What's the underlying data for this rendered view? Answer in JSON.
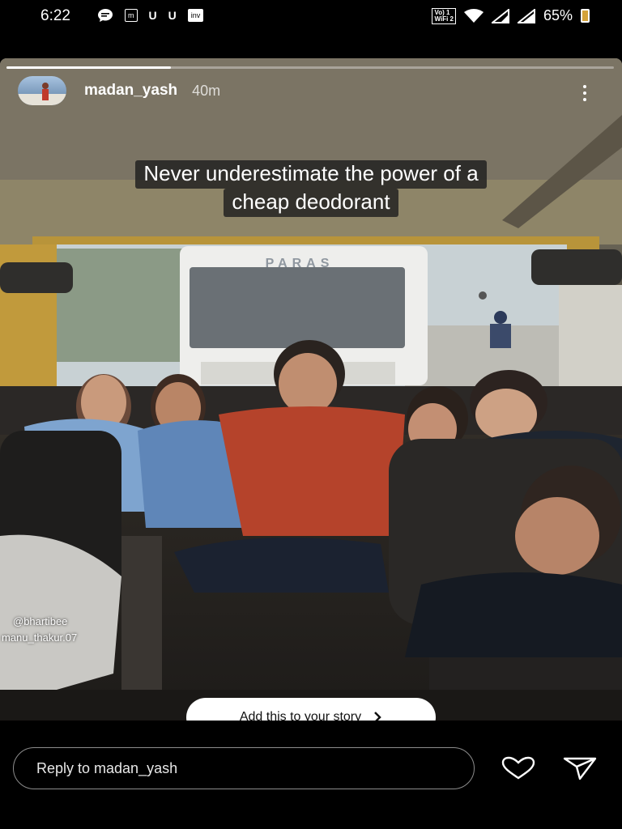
{
  "status_bar": {
    "time": "6:22",
    "notifications": [
      "chat-bubble-icon",
      "message-icon",
      "U",
      "U",
      "inshorts-icon"
    ],
    "network_label_1": "Vo) 1",
    "network_label_2": "WiFi 2",
    "battery": "65%"
  },
  "story": {
    "progress": 0.27,
    "username": "madan_yash",
    "time_ago": "40m",
    "caption_lines": [
      "Never underestimate the power of a",
      "cheap deodorant"
    ],
    "bus_sign": "PARAS",
    "mentions": [
      "@bhartibee",
      "manu_thakur.07"
    ],
    "add_story_label": "Add this to your story"
  },
  "footer": {
    "reply_placeholder": "Reply to madan_yash"
  },
  "colors": {
    "background": "#000000",
    "add_story_bg": "#ffffff",
    "accent": "#ffffff"
  }
}
